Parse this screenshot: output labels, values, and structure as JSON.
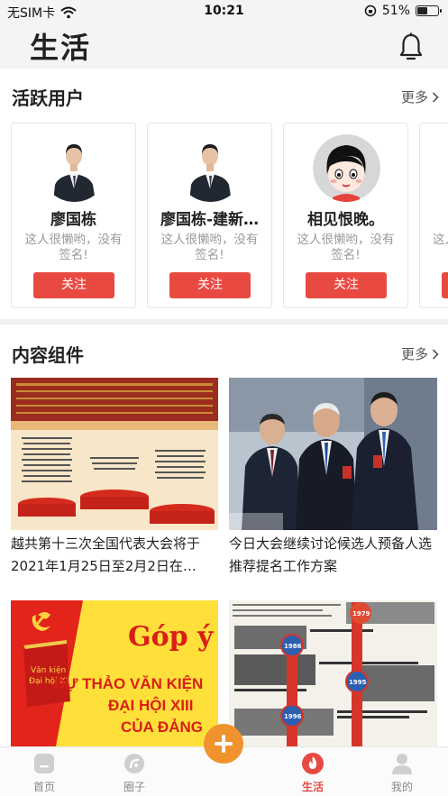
{
  "status_bar": {
    "carrier": "无SIM卡",
    "time": "10:21",
    "battery": "51%",
    "battery_level": 0.51
  },
  "header": {
    "title": "生活"
  },
  "active_users": {
    "title": "活跃用户",
    "more_label": "更多",
    "users": [
      {
        "name": "廖国栋",
        "signature": "这人很懒哟，没有签名!",
        "follow_label": "关注"
      },
      {
        "name": "廖国栋-建新…",
        "signature": "这人很懒哟，没有签名!",
        "follow_label": "关注"
      },
      {
        "name": "相见恨晚。",
        "signature": "这人很懒哟，没有签名!",
        "follow_label": "关注"
      },
      {
        "name": "",
        "signature": "这人",
        "follow_label": ""
      }
    ]
  },
  "content": {
    "title": "内容组件",
    "more_label": "更多",
    "items": [
      {
        "title": "越共第十三次全国代表大会将于2021年1月25日至2月2日在…"
      },
      {
        "title": "今日大会继续讨论候选人预备人选推荐提名工作方案"
      },
      {
        "title": ""
      },
      {
        "title": ""
      }
    ],
    "poster_text": {
      "gop_y": "Góp ý",
      "line1": "DỰ THẢO VĂN KIỆN",
      "line2": "ĐẠI HỘI XIII",
      "line3": "CỦA ĐẢNG",
      "book_line1": "Văn kiện",
      "book_line2": "Đại hội XIII"
    },
    "timeline_years": [
      "1979",
      "1986",
      "1995",
      "1996"
    ]
  },
  "tabbar": {
    "tabs": [
      {
        "label": "首页",
        "icon": "home-icon"
      },
      {
        "label": "圈子",
        "icon": "circle-icon"
      },
      {
        "label": "",
        "icon": "plus-icon"
      },
      {
        "label": "生活",
        "icon": "flame-icon"
      },
      {
        "label": "我的",
        "icon": "person-icon"
      }
    ]
  },
  "colors": {
    "accent": "#e84a42",
    "plus": "#f0922e"
  }
}
